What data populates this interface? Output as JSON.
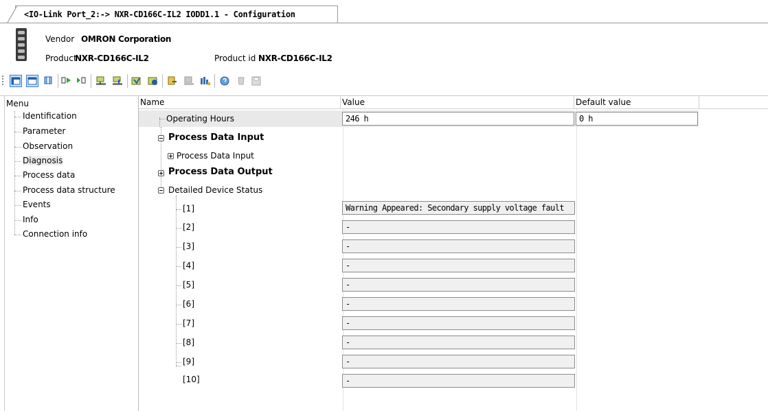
{
  "tab": {
    "title": "<IO-Link Port_2:-> NXR-CD166C-IL2 IODD1.1 - Configuration"
  },
  "device": {
    "image_icon": "device-module-icon",
    "vendor_label": "Vendor",
    "vendor_value": "OMRON Corporation",
    "product_label": "Product",
    "product_value": "NXR-CD166C-IL2",
    "product_id_label": "Product id",
    "product_id_value": "NXR-CD166C-IL2"
  },
  "toolbar": {
    "buttons": [
      "view-layout-1-icon",
      "view-layout-2-icon",
      "view-layout-3-icon",
      "go-online-icon",
      "go-offline-icon",
      "upload-icon",
      "download-icon",
      "verify-icon",
      "compare-icon",
      "import-icon",
      "export-icon",
      "process-data-icon",
      "help-icon",
      "clear-icon",
      "save-icon"
    ]
  },
  "menu": {
    "title": "Menu",
    "items": [
      "Identification",
      "Parameter",
      "Observation",
      "Diagnosis",
      "Process data",
      "Process data structure",
      "Events",
      "Info",
      "Connection info"
    ],
    "selected": "Diagnosis"
  },
  "grid": {
    "columns": {
      "name": "Name",
      "value": "Value",
      "default": "Default value"
    },
    "operating_hours": {
      "name": "Operating Hours",
      "value": "246 h",
      "default": "0 h"
    },
    "pdi_group": "Process Data Input",
    "pdi_child": "Process Data Input",
    "pdo_group": "Process Data Output",
    "status_group": "Detailed Device Status",
    "status_rows": [
      {
        "name": "[1]",
        "value": "Warning Appeared: Secondary supply voltage fault"
      },
      {
        "name": "[2]",
        "value": "-"
      },
      {
        "name": "[3]",
        "value": "-"
      },
      {
        "name": "[4]",
        "value": "-"
      },
      {
        "name": "[5]",
        "value": "-"
      },
      {
        "name": "[6]",
        "value": "-"
      },
      {
        "name": "[7]",
        "value": "-"
      },
      {
        "name": "[8]",
        "value": "-"
      },
      {
        "name": "[9]",
        "value": "-"
      },
      {
        "name": "[10]",
        "value": "-"
      }
    ]
  }
}
